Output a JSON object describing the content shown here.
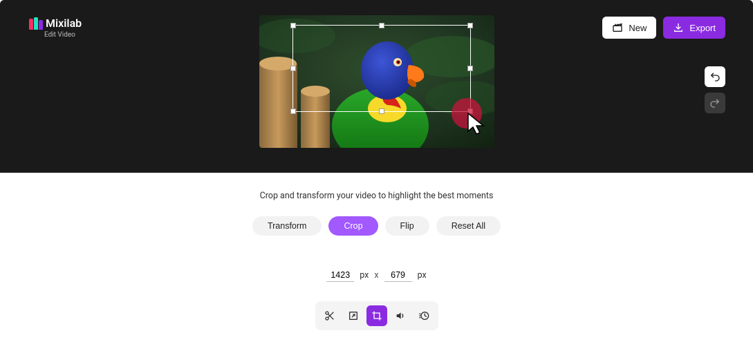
{
  "app": {
    "name": "Mixilab",
    "subtitle": "Edit Video"
  },
  "header": {
    "new_label": "New",
    "export_label": "Export"
  },
  "undo_redo": {
    "undo_name": "undo",
    "redo_name": "redo"
  },
  "crop": {
    "hint": "Crop and transform your video to highlight the best moments",
    "tabs": {
      "transform": "Transform",
      "crop": "Crop",
      "flip": "Flip",
      "reset": "Reset All"
    },
    "width": "1423",
    "height": "679",
    "unit": "px",
    "sep": "x"
  },
  "tools": {
    "cut": "cut-icon",
    "resize": "resize-icon",
    "crop": "crop-icon",
    "volume": "volume-icon",
    "speed": "speed-icon"
  },
  "colors": {
    "accent": "#8a2be2"
  }
}
